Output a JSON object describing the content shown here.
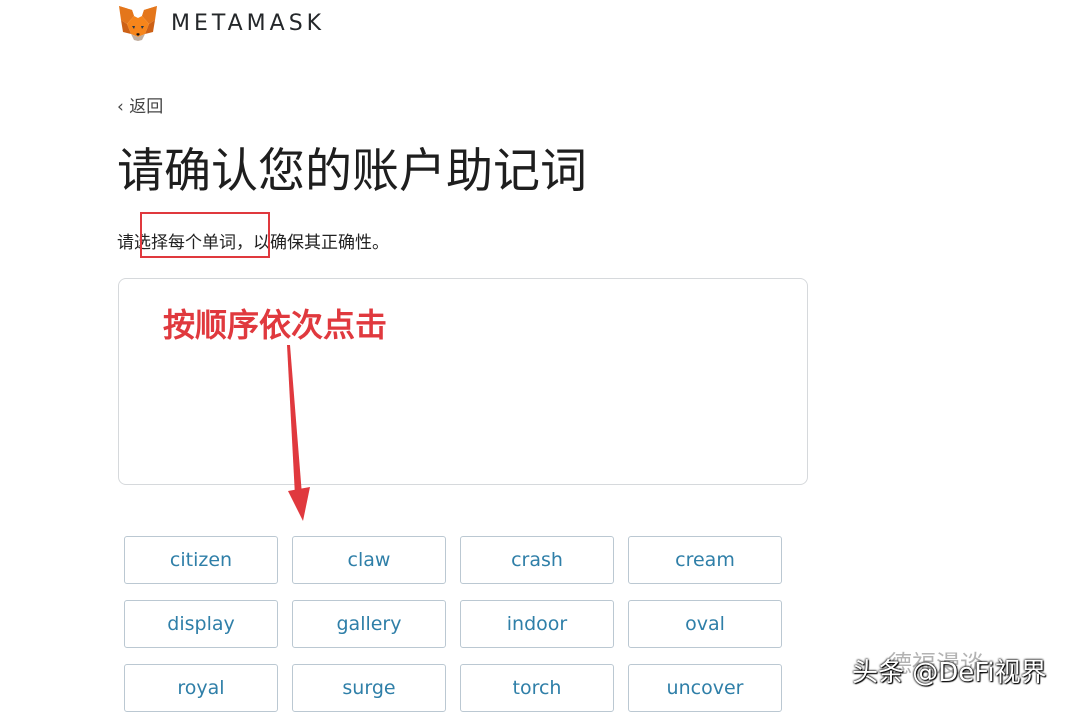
{
  "header": {
    "logo_text": "METAMASK",
    "logo_icon": "metamask-fox-icon"
  },
  "nav": {
    "back_label": "‹ 返回"
  },
  "title": "请确认您的账户助记词",
  "instructions": "请选择每个单词，以确保其正确性。",
  "annotation": {
    "text": "按顺序依次点击",
    "color": "#e0393e"
  },
  "words": [
    "citizen",
    "claw",
    "crash",
    "cream",
    "display",
    "gallery",
    "indoor",
    "oval",
    "royal",
    "surge",
    "torch",
    "uncover"
  ],
  "watermark": {
    "faded_text": "德福漫谈",
    "text": "头条 @DeFi视界"
  },
  "colors": {
    "word_text": "#2f7fa8",
    "border": "#bbc8d2",
    "annotation_red": "#e0393e"
  }
}
